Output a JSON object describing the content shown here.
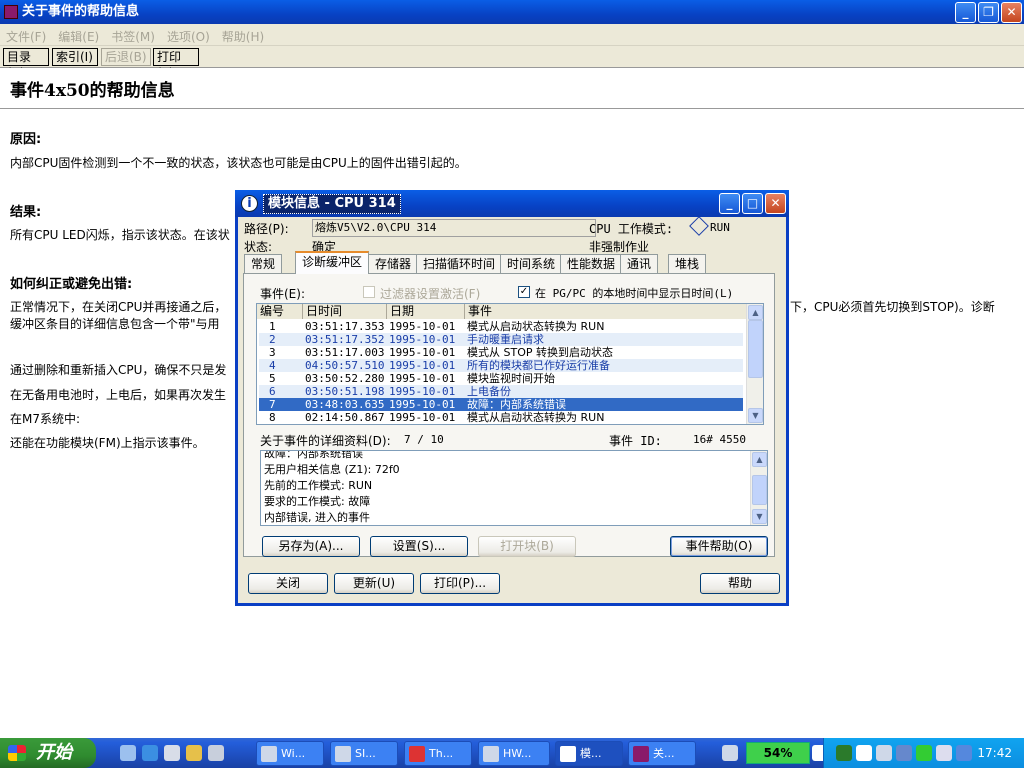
{
  "help_window": {
    "title": "关于事件的帮助信息",
    "menu": [
      "文件(F)",
      "编辑(E)",
      "书签(M)",
      "选项(O)",
      "帮助(H)"
    ],
    "toolbar": {
      "contents": "目录(C)",
      "index": "索引(I)",
      "back": "后退(B)",
      "print": "打印(P)"
    },
    "heading": "事件4x50的帮助信息",
    "cause_title": "原因:",
    "cause_text": "内部CPU固件检测到一个不一致的状态，该状态也可能是由CPU上的固件出错引起的。",
    "result_title": "结果:",
    "result_text": "所有CPU LED闪烁，指示该状态。在该状",
    "fix_title": "如何纠正或避免出错:",
    "fix_text_1": "正常情况下，在关闭CPU并再接通之后，",
    "fix_text_1_right": "下，CPU必须首先切换到STOP)。诊断",
    "fix_text_2": "缓冲区条目的详细信息包含一个带\"与用",
    "text_3": "通过删除和重新插入CPU，确保不只是发",
    "text_4": "在无备用电池时，上电后，如果再次发生",
    "text_5": "在M7系统中:",
    "text_6": "还能在功能模块(FM)上指示该事件。"
  },
  "dialog": {
    "title": "模块信息 - CPU 314",
    "path_label": "路径(P):",
    "path_value": "熔炼V5\\V2.0\\CPU 314",
    "status_label": "状态:",
    "status_value": "确定",
    "cpu_mode_label": "CPU 工作模式:",
    "cpu_mode_value": "RUN",
    "cpu_mode_sub": "非强制作业",
    "tabs": [
      "常规",
      "诊断缓冲区",
      "存储器",
      "扫描循环时间",
      "时间系统",
      "性能数据",
      "通讯",
      "堆栈"
    ],
    "events_label": "事件(E):",
    "filter_label": "过滤器设置激活(F)",
    "local_time_label": "在 PG/PC 的本地时间中显示日时间(L)",
    "columns": [
      "编号",
      "日时间",
      "日期",
      "事件"
    ],
    "events": [
      {
        "no": "1",
        "time": "03:51:17.353",
        "date": "1995-10-01",
        "event": "模式从启动状态转换为 RUN"
      },
      {
        "no": "2",
        "time": "03:51:17.352",
        "date": "1995-10-01",
        "event": "手动暖重启请求"
      },
      {
        "no": "3",
        "time": "03:51:17.003",
        "date": "1995-10-01",
        "event": "模式从 STOP 转换到启动状态"
      },
      {
        "no": "4",
        "time": "04:50:57.510",
        "date": "1995-10-01",
        "event": "所有的模块都已作好运行准备"
      },
      {
        "no": "5",
        "time": "03:50:52.280",
        "date": "1995-10-01",
        "event": "模块监视时间开始"
      },
      {
        "no": "6",
        "time": "03:50:51.198",
        "date": "1995-10-01",
        "event": "上电备份"
      },
      {
        "no": "7",
        "time": "03:48:03.635",
        "date": "1995-10-01",
        "event": "故障：内部系统错误"
      },
      {
        "no": "8",
        "time": "02:14:50.867",
        "date": "1995-10-01",
        "event": "模式从启动状态转换为 RUN"
      }
    ],
    "details_label": "关于事件的详细资料(D):",
    "details_count": "7 / 10",
    "event_id_label": "事件 ID:",
    "event_id_value": "16# 4550",
    "detail_lines": [
      "故障：内部系统错误",
      "无用户相关信息 (Z1): 72f0",
      "  先前的工作模式: RUN",
      "要求的工作模式: 故障",
      "内部错误, 进入的事件"
    ],
    "btn_save_as": "另存为(A)...",
    "btn_settings": "设置(S)...",
    "btn_open_block": "打开块(B)",
    "btn_event_help": "事件帮助(O)",
    "btn_close": "关闭",
    "btn_update": "更新(U)",
    "btn_print": "打印(P)...",
    "btn_help": "帮助"
  },
  "taskbar": {
    "start_label": "开始",
    "tasks": [
      "Wi...",
      "SI...",
      "Th...",
      "HW...",
      "模...",
      "关..."
    ],
    "battery": "54%",
    "clock": "17:42"
  }
}
